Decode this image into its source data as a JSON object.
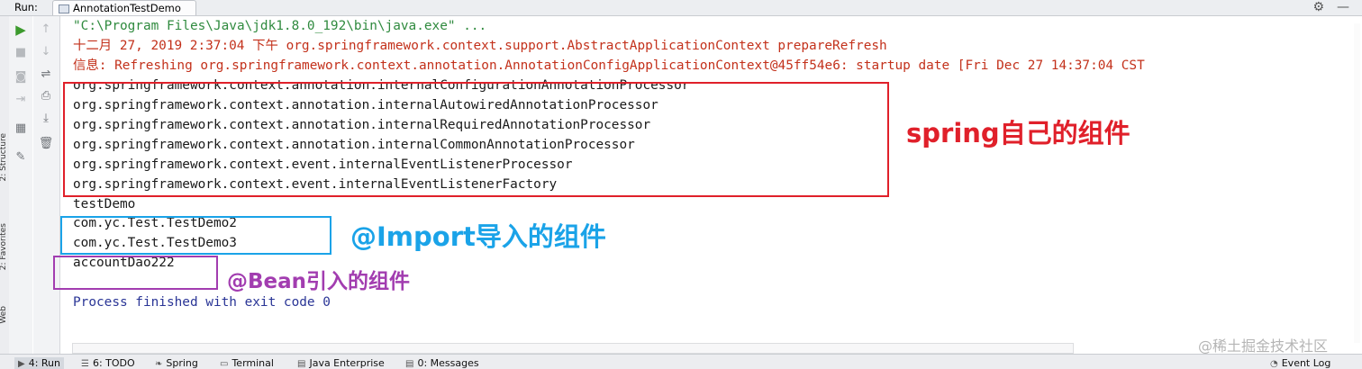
{
  "header": {
    "run_label": "Run:",
    "tab_label": "AnnotationTestDemo",
    "settings_icon": "gear-icon",
    "minimize_icon": "minimize-icon"
  },
  "side_tabs": [
    "2: Structure",
    "2: Favorites",
    "Web"
  ],
  "toolbar": {
    "col1": [
      "rerun-icon",
      "stop-icon",
      "camera-icon",
      "exit-icon",
      "layout-icon",
      "pin-icon"
    ],
    "col2": [
      "up-arrow-icon",
      "down-arrow-icon",
      "soft-wrap-icon",
      "print-icon",
      "scroll-end-icon",
      "trash-icon"
    ]
  },
  "console": {
    "cmd": "\"C:\\Program Files\\Java\\jdk1.8.0_192\\bin\\java.exe\" ...",
    "log1": "十二月 27, 2019 2:37:04 下午 org.springframework.context.support.AbstractApplicationContext prepareRefresh",
    "log2": "信息: Refreshing org.springframework.context.annotation.AnnotationConfigApplicationContext@45ff54e6: startup date [Fri Dec 27 14:37:04 CST",
    "spring_components": [
      "org.springframework.context.annotation.internalConfigurationAnnotationProcessor",
      "org.springframework.context.annotation.internalAutowiredAnnotationProcessor",
      "org.springframework.context.annotation.internalRequiredAnnotationProcessor",
      "org.springframework.context.annotation.internalCommonAnnotationProcessor",
      "org.springframework.context.event.internalEventListenerProcessor",
      "org.springframework.context.event.internalEventListenerFactory"
    ],
    "test_demo": "testDemo",
    "import_components": [
      "com.yc.Test.TestDemo2",
      "com.yc.Test.TestDemo3"
    ],
    "bean_component": "accountDao222",
    "process_finished": "Process finished with exit code 0"
  },
  "annotations": {
    "spring": "spring自己的组件",
    "import": "@Import导入的组件",
    "bean": "@Bean引入的组件"
  },
  "colors": {
    "cmd_green": "#2f8a3e",
    "log_red": "#c3311b",
    "process_blue": "#2a3596",
    "box_red": "#e0202a",
    "box_blue": "#1aa3e8",
    "box_purple": "#a23db0"
  },
  "watermark": "@稀土掘金技术社区",
  "bottom_tabs": [
    {
      "label": "4: Run",
      "icon": "run-icon"
    },
    {
      "label": "6: TODO",
      "icon": "todo-icon"
    },
    {
      "label": "Spring",
      "icon": "spring-icon"
    },
    {
      "label": "Terminal",
      "icon": "terminal-icon"
    },
    {
      "label": "Java Enterprise",
      "icon": "java-enterprise-icon"
    },
    {
      "label": "0: Messages",
      "icon": "messages-icon"
    }
  ],
  "event_log": "Event Log"
}
